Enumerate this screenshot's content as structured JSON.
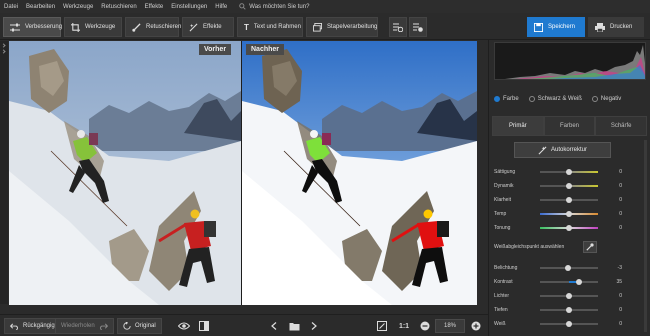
{
  "menu": {
    "items": [
      "Datei",
      "Bearbeiten",
      "Werkzeuge",
      "Retuschieren",
      "Effekte",
      "Einstellungen",
      "Hilfe"
    ],
    "search_placeholder": "Was möchten Sie tun?"
  },
  "toolbar": {
    "tabs": [
      "Verbesserung",
      "Werkzeuge",
      "Retuschieren",
      "Effekte",
      "Text und Rahmen",
      "Stapelverarbeitung"
    ],
    "active_tab": "Verbesserung",
    "save_label": "Speichern",
    "print_label": "Drucken"
  },
  "preview": {
    "before_label": "Vorher",
    "after_label": "Nachher"
  },
  "bottombar": {
    "undo_label": "Rückgängig",
    "redo_label": "Wiederholen",
    "original_label": "Original",
    "fit_label": "1:1",
    "zoom": "18%"
  },
  "panel": {
    "modes": [
      "Farbe",
      "Schwarz & Weiß",
      "Negativ"
    ],
    "selected_mode": "Farbe",
    "tabs": [
      "Primär",
      "Farben",
      "Schärfe"
    ],
    "active_tab": "Primär",
    "auto_label": "Autokorrektur",
    "wb_label": "Weißabgleichspunkt auswählen",
    "sliders_top": [
      {
        "label": "Sättigung",
        "value": "0"
      },
      {
        "label": "Dynamik",
        "value": "0"
      },
      {
        "label": "Klarheit",
        "value": "0"
      },
      {
        "label": "Temp",
        "value": "0"
      },
      {
        "label": "Tonung",
        "value": "0"
      }
    ],
    "sliders_bottom": [
      {
        "label": "Belichtung",
        "value": "-3"
      },
      {
        "label": "Kontrast",
        "value": "35"
      },
      {
        "label": "Lichter",
        "value": "0"
      },
      {
        "label": "Tiefen",
        "value": "0"
      },
      {
        "label": "Weiß",
        "value": "0"
      }
    ]
  },
  "colors": {
    "accent": "#1f7ad0",
    "panel_bg": "#2b2b2b"
  }
}
